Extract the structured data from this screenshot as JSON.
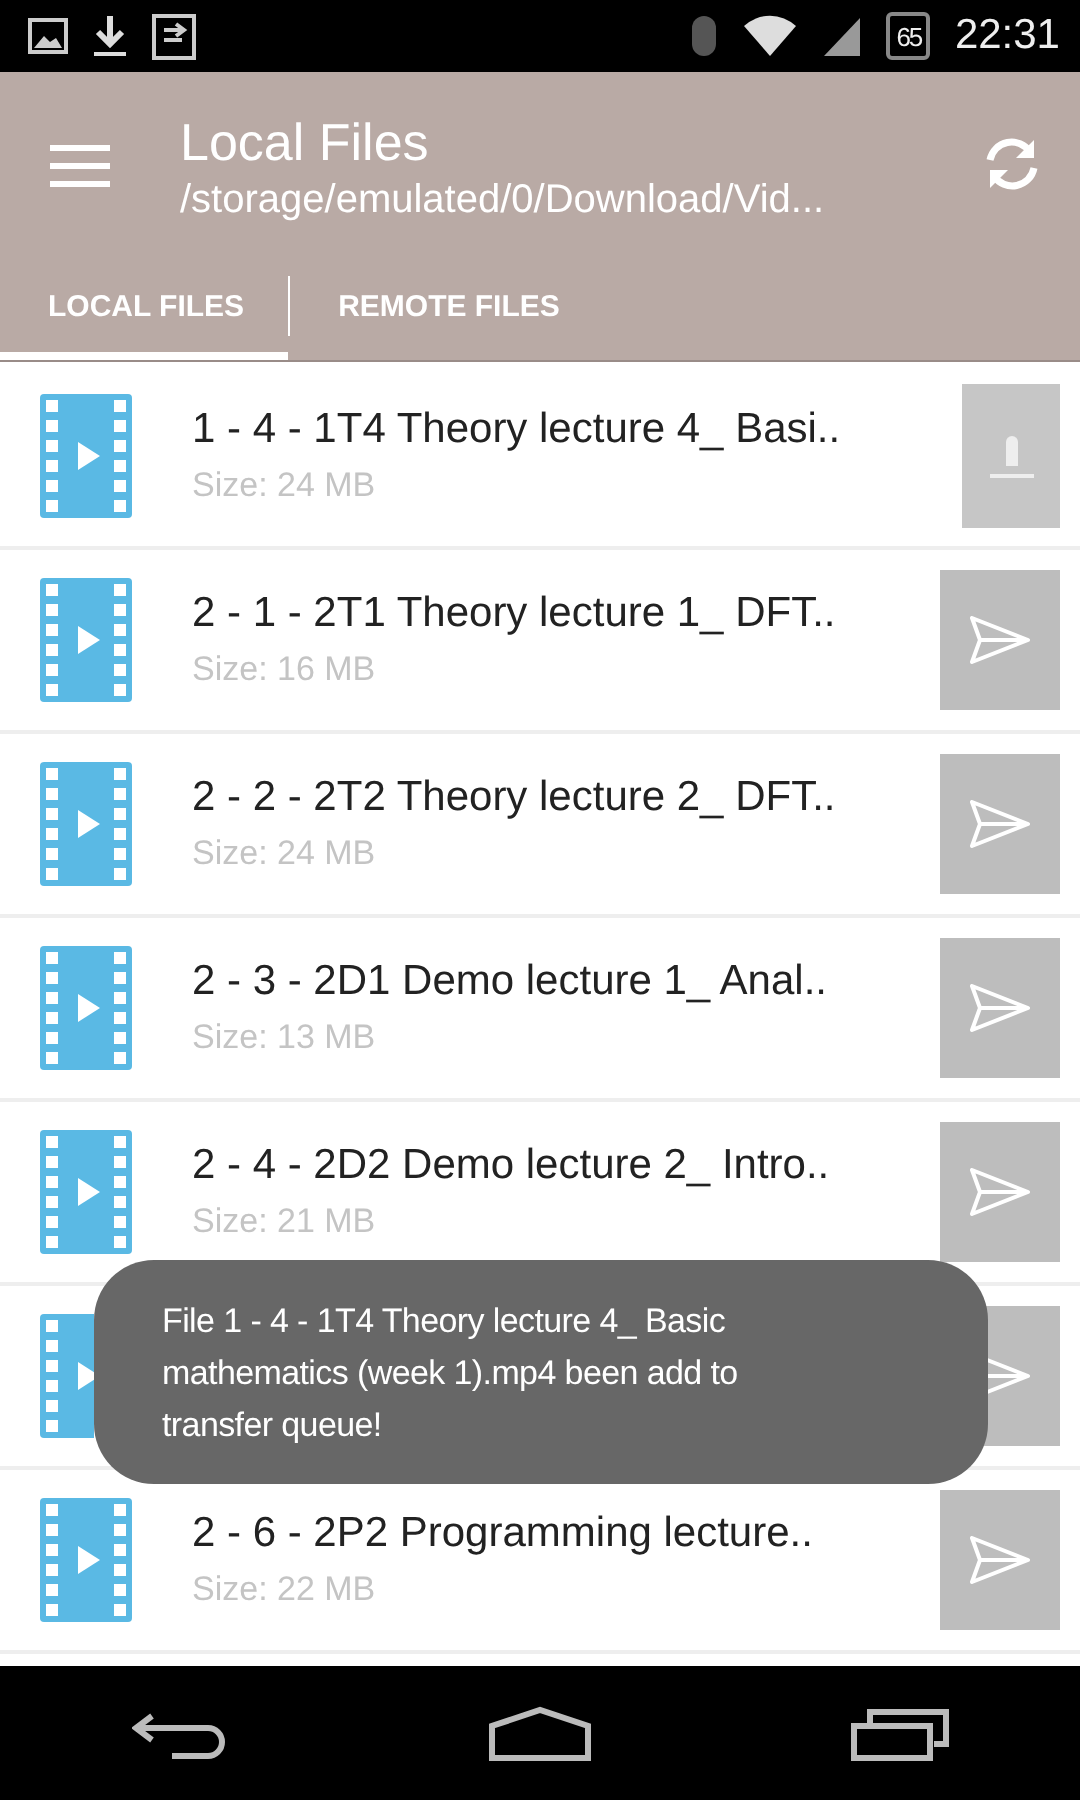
{
  "status_bar": {
    "battery": "65",
    "time": "22:31"
  },
  "toolbar": {
    "title": "Local Files",
    "subtitle": "/storage/emulated/0/Download/Vid..."
  },
  "tabs": [
    {
      "label": "LOCAL FILES",
      "selected": true
    },
    {
      "label": "REMOTE FILES",
      "selected": false
    }
  ],
  "files": [
    {
      "title": "1 - 4 - 1T4 Theory lecture 4_ Basi..",
      "size": "Size: 24 MB",
      "kind": "queued"
    },
    {
      "title": "2 - 1 - 2T1 Theory lecture 1_ DFT..",
      "size": "Size: 16 MB",
      "kind": "send"
    },
    {
      "title": "2 - 2 - 2T2 Theory lecture 2_ DFT..",
      "size": "Size: 24 MB",
      "kind": "send"
    },
    {
      "title": "2 - 3 - 2D1 Demo lecture 1_ Anal..",
      "size": "Size: 13 MB",
      "kind": "send"
    },
    {
      "title": "2 - 4 - 2D2 Demo lecture 2_ Intro..",
      "size": "Size: 21 MB",
      "kind": "send"
    },
    {
      "kind": "send"
    },
    {
      "title": "2 - 6 - 2P2 Programming lecture..",
      "size": "Size: 22 MB",
      "kind": "send"
    }
  ],
  "toast": {
    "text": "File 1 - 4 - 1T4 Theory lecture 4_ Basic mathematics (week 1).mp4 been add to transfer queue!"
  }
}
